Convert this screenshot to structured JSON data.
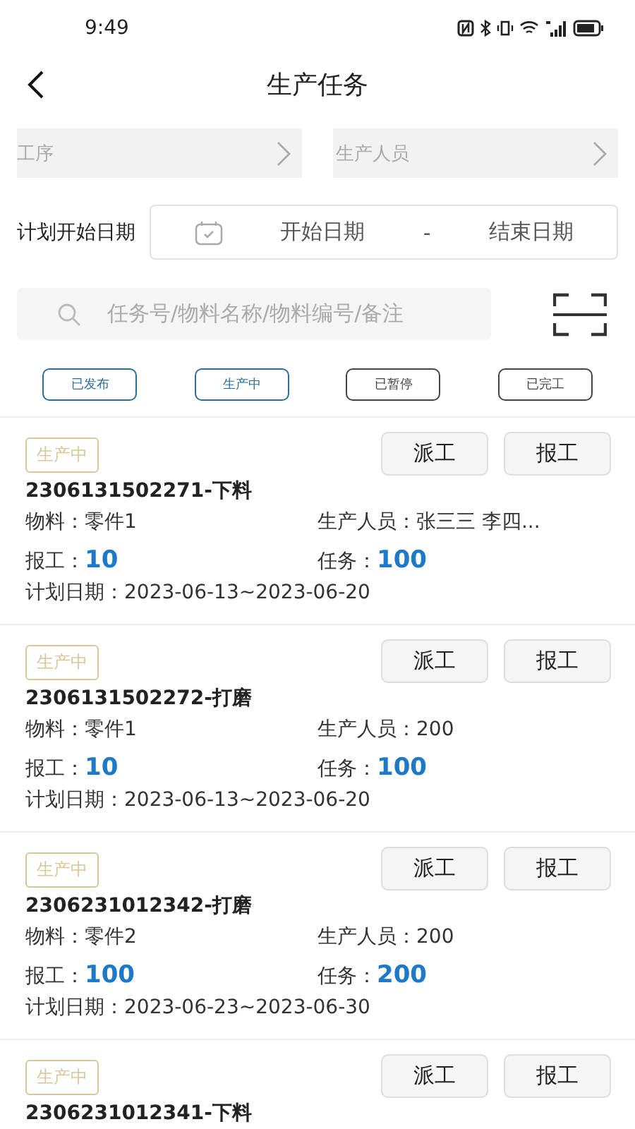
{
  "status_bar": {
    "time": "9:49"
  },
  "header": {
    "title": "生产任务"
  },
  "filters": [
    {
      "placeholder": "工序"
    },
    {
      "placeholder": "生产人员"
    }
  ],
  "date_range": {
    "label": "计划开始日期",
    "start_placeholder": "开始日期",
    "separator": "-",
    "end_placeholder": "结束日期"
  },
  "search": {
    "placeholder": "任务号/物料名称/物料编号/备注"
  },
  "status_tabs": [
    {
      "label": "已发布",
      "color": "#2a6f97"
    },
    {
      "label": "生产中",
      "color": "#2a6f97"
    },
    {
      "label": "已暂停",
      "color": "#444444"
    },
    {
      "label": "已完工",
      "color": "#444444"
    }
  ],
  "tasks": [
    {
      "status": "生产中",
      "title": "2306131502271-下料",
      "material_label": "物料：",
      "material": "零件1",
      "staff_label": "生产人员：",
      "staff": "张三三 李四...",
      "reported_label": "报工：",
      "reported": "10",
      "task_label": "任务：",
      "task": "100",
      "date_label": "计划日期：",
      "date": "2023-06-13~2023-06-20",
      "buttons": [
        "派工",
        "报工"
      ]
    },
    {
      "status": "生产中",
      "title": "2306131502272-打磨",
      "material_label": "物料：",
      "material": "零件1",
      "staff_label": "生产人员：",
      "staff": "200",
      "reported_label": "报工：",
      "reported": "10",
      "task_label": "任务：",
      "task": "100",
      "date_label": "计划日期：",
      "date": "2023-06-13~2023-06-20",
      "buttons": [
        "派工",
        "报工"
      ]
    },
    {
      "status": "生产中",
      "title": "2306231012342-打磨",
      "material_label": "物料：",
      "material": "零件2",
      "staff_label": "生产人员：",
      "staff": "200",
      "reported_label": "报工：",
      "reported": "100",
      "task_label": "任务：",
      "task": "200",
      "date_label": "计划日期：",
      "date": "2023-06-23~2023-06-30",
      "buttons": [
        "派工",
        "报工"
      ]
    },
    {
      "status": "生产中",
      "title": "2306231012341-下料",
      "buttons": [
        "派工",
        "报工"
      ]
    }
  ]
}
